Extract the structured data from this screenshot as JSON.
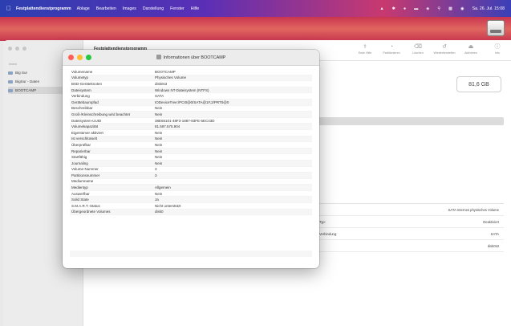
{
  "menubar": {
    "app_name": "Festplattendienstprogramm",
    "menus": [
      "Ablage",
      "Bearbeiten",
      "Images",
      "Darstellung",
      "Fenster",
      "Hilfe"
    ],
    "clock": "Sa. 26. Jul. 15:08"
  },
  "sidebar": {
    "section": "Intern",
    "items": [
      {
        "label": "Big Sur"
      },
      {
        "label": "BigSur - Daten"
      },
      {
        "label": "BOOTCAMP"
      }
    ]
  },
  "toolbar": {
    "title": "Festplattendienstprogramm",
    "tools": [
      "Erste Hilfe",
      "Partitionieren",
      "Löschen",
      "Wiederherstellen",
      "Aktivieren",
      "Info"
    ]
  },
  "main": {
    "capacity": "81,6 GB",
    "details": [
      {
        "label": "",
        "value": "SATA Internes physisches Volume"
      },
      {
        "label": "Typ:",
        "value": "Deaktiviert"
      },
      {
        "label": "Verbindung:",
        "value": "SATA"
      },
      {
        "label": "",
        "value": "disk0s3"
      }
    ]
  },
  "dialog": {
    "title": "Informationen über BOOTCAMP",
    "rows": [
      {
        "key": "Volumename",
        "value": "BOOTCAMP"
      },
      {
        "key": "Volumetyp",
        "value": "Physisches Volume"
      },
      {
        "key": "BSD-Geräteknoten",
        "value": "disk0s3"
      },
      {
        "key": "Dateisystem",
        "value": "Windows NT-Dateisystem (NTFS)"
      },
      {
        "key": "Verbindung",
        "value": "SATA"
      },
      {
        "key": "Gerätebaumpfad",
        "value": "IODeviceTree:/PCI0@0/SATA@1F,2/PRT0@0"
      },
      {
        "key": "Beschreibbar",
        "value": "Nein"
      },
      {
        "key": "Groß-/Kleinschreibung wird beachtet",
        "value": "Nein"
      },
      {
        "key": "Dateisystem-UUID",
        "value": "38E65101-48F3-1887-83FE-5EC43D"
      },
      {
        "key": "Volumekapazität",
        "value": "81.597.575.904"
      },
      {
        "key": "Eigentümer aktiviert",
        "value": "Nein"
      },
      {
        "key": "Ist verschlüsselt",
        "value": "Nein"
      },
      {
        "key": "Überprüfbar",
        "value": "Nein"
      },
      {
        "key": "Reparierbar",
        "value": "Nein"
      },
      {
        "key": "Startfähig",
        "value": "Nein"
      },
      {
        "key": "Journaling",
        "value": "Nein"
      },
      {
        "key": "Volume-Nummer",
        "value": "3"
      },
      {
        "key": "Partitionsnummer",
        "value": "3"
      },
      {
        "key": "Mediumname",
        "value": ""
      },
      {
        "key": "Medientyp",
        "value": "Allgemein"
      },
      {
        "key": "Auswerfbar",
        "value": "Nein"
      },
      {
        "key": "Solid State",
        "value": "Ja"
      },
      {
        "key": "S.M.A.R.T.-Status",
        "value": "Nicht unterstützt"
      },
      {
        "key": "Übergeordnete Volumes",
        "value": "disk0"
      }
    ]
  }
}
